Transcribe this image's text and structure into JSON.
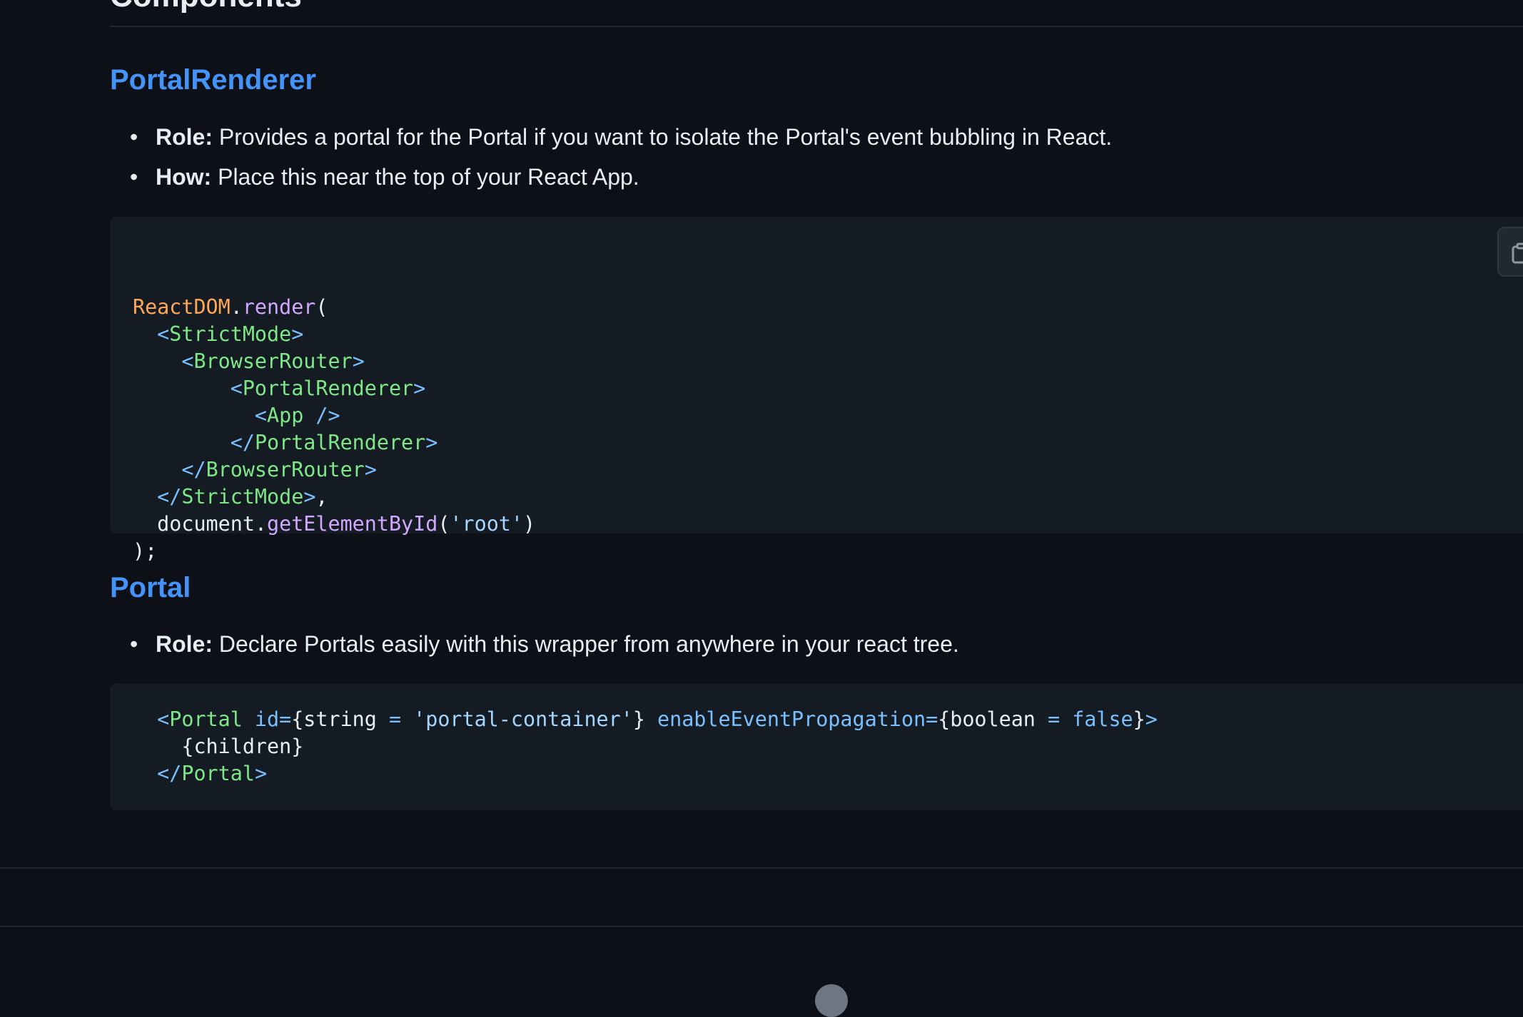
{
  "section_heading": "Components",
  "portal_renderer": {
    "heading": "PortalRenderer",
    "items": [
      {
        "label": "Role:",
        "text": " Provides a portal for the Portal if you want to isolate the Portal's event bubbling in React."
      },
      {
        "label": "How:",
        "text": " Place this near the top of your React App."
      }
    ],
    "code": [
      [
        {
          "t": "ReactDOM",
          "c": "var"
        },
        {
          "t": ".",
          "c": "plain"
        },
        {
          "t": "render",
          "c": "fn"
        },
        {
          "t": "(",
          "c": "plain"
        }
      ],
      [
        {
          "t": "  <",
          "c": "punct"
        },
        {
          "t": "StrictMode",
          "c": "tag"
        },
        {
          "t": ">",
          "c": "punct"
        }
      ],
      [
        {
          "t": "    <",
          "c": "punct"
        },
        {
          "t": "BrowserRouter",
          "c": "tag"
        },
        {
          "t": ">",
          "c": "punct"
        }
      ],
      [
        {
          "t": "        <",
          "c": "punct"
        },
        {
          "t": "PortalRenderer",
          "c": "tag"
        },
        {
          "t": ">",
          "c": "punct"
        }
      ],
      [
        {
          "t": "          <",
          "c": "punct"
        },
        {
          "t": "App",
          "c": "tag"
        },
        {
          "t": " />",
          "c": "punct"
        }
      ],
      [
        {
          "t": "        </",
          "c": "punct"
        },
        {
          "t": "PortalRenderer",
          "c": "tag"
        },
        {
          "t": ">",
          "c": "punct"
        }
      ],
      [
        {
          "t": "    </",
          "c": "punct"
        },
        {
          "t": "BrowserRouter",
          "c": "tag"
        },
        {
          "t": ">",
          "c": "punct"
        }
      ],
      [
        {
          "t": "  </",
          "c": "punct"
        },
        {
          "t": "StrictMode",
          "c": "tag"
        },
        {
          "t": ">",
          "c": "punct"
        },
        {
          "t": ",",
          "c": "plain"
        }
      ],
      [
        {
          "t": "  document.",
          "c": "plain"
        },
        {
          "t": "getElementById",
          "c": "fn"
        },
        {
          "t": "(",
          "c": "plain"
        },
        {
          "t": "'root'",
          "c": "str"
        },
        {
          "t": ")",
          "c": "plain"
        }
      ],
      [
        {
          "t": ");",
          "c": "plain"
        }
      ]
    ]
  },
  "portal": {
    "heading": "Portal",
    "items": [
      {
        "label": "Role:",
        "text": " Declare Portals easily with this wrapper from anywhere in your react tree."
      }
    ],
    "code": [
      [
        {
          "t": "  <",
          "c": "punct"
        },
        {
          "t": "Portal",
          "c": "tag"
        },
        {
          "t": " id",
          "c": "attr"
        },
        {
          "t": "=",
          "c": "punct"
        },
        {
          "t": "{string ",
          "c": "plain"
        },
        {
          "t": "=",
          "c": "kw"
        },
        {
          "t": " ",
          "c": "plain"
        },
        {
          "t": "'portal-container'",
          "c": "str"
        },
        {
          "t": "} ",
          "c": "plain"
        },
        {
          "t": "enableEventPropagation",
          "c": "attr"
        },
        {
          "t": "=",
          "c": "punct"
        },
        {
          "t": "{boolean ",
          "c": "plain"
        },
        {
          "t": "=",
          "c": "kw"
        },
        {
          "t": " ",
          "c": "plain"
        },
        {
          "t": "false",
          "c": "kw"
        },
        {
          "t": "}",
          "c": "plain"
        },
        {
          "t": ">",
          "c": "punct"
        }
      ],
      [
        {
          "t": "    {children}",
          "c": "plain"
        }
      ],
      [
        {
          "t": "  </",
          "c": "punct"
        },
        {
          "t": "Portal",
          "c": "tag"
        },
        {
          "t": ">",
          "c": "punct"
        }
      ]
    ]
  },
  "colors": {
    "background": "#0d1117",
    "code_background": "#151b23",
    "heading_link": "#4493f8"
  }
}
